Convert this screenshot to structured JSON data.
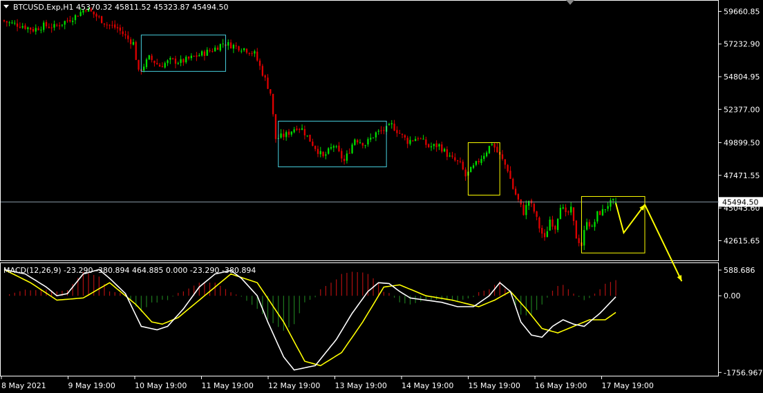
{
  "symbol_line": "BTCUSD.Exp,H1  45370.32 45811.52 45323.87 45494.50",
  "macd_label": "MACD(12,26,9) -23.290 -380.894 464.885 0.000 -23.290 -380.894",
  "current_price_label": "45494.50",
  "colors": {
    "bull": "#00e000",
    "bear": "#e00000",
    "macd_main": "#ffffff",
    "macd_signal": "#ffff00",
    "hist_pos": "#b01010",
    "hist_neg": "#1e7a1e",
    "box_cyan": "#48d1e0",
    "box_yellow": "#ffff00",
    "arrow": "#ffff00",
    "grid": "#ffffff"
  },
  "chart_data": [
    {
      "type": "candlestick",
      "title": "BTCUSD.Exp,H1",
      "ohlc_current": {
        "open": 45370.32,
        "high": 45811.52,
        "low": 45323.87,
        "close": 45494.5
      },
      "y_ticks": [
        59660.85,
        57232.9,
        54804.95,
        52377.0,
        49899.5,
        47471.55,
        45043.6,
        42615.65
      ],
      "ylim": [
        41200,
        60300
      ],
      "x_ticks": [
        "8 May 2021",
        "9 May 19:00",
        "10 May 19:00",
        "11 May 19:00",
        "12 May 19:00",
        "13 May 19:00",
        "14 May 19:00",
        "15 May 19:00",
        "16 May 19:00",
        "17 May 19:00"
      ],
      "current_price": 45494.5,
      "price_path": [
        [
          0,
          59000
        ],
        [
          3,
          58800
        ],
        [
          8,
          58600
        ],
        [
          12,
          58300
        ],
        [
          16,
          58600
        ],
        [
          20,
          58500
        ],
        [
          24,
          58900
        ],
        [
          28,
          59300
        ],
        [
          32,
          59900
        ],
        [
          36,
          59300
        ],
        [
          40,
          58700
        ],
        [
          44,
          58400
        ],
        [
          48,
          57600
        ],
        [
          50,
          57300
        ],
        [
          52,
          55100
        ],
        [
          56,
          56200
        ],
        [
          60,
          55600
        ],
        [
          64,
          56000
        ],
        [
          68,
          55900
        ],
        [
          72,
          56200
        ],
        [
          76,
          56500
        ],
        [
          80,
          56800
        ],
        [
          84,
          57300
        ],
        [
          88,
          57100
        ],
        [
          92,
          56900
        ],
        [
          96,
          56500
        ],
        [
          100,
          54600
        ],
        [
          102,
          53600
        ],
        [
          104,
          50200
        ],
        [
          108,
          50500
        ],
        [
          112,
          51100
        ],
        [
          114,
          50900
        ],
        [
          118,
          49800
        ],
        [
          122,
          48800
        ],
        [
          126,
          49700
        ],
        [
          130,
          48500
        ],
        [
          134,
          50200
        ],
        [
          138,
          49800
        ],
        [
          142,
          50600
        ],
        [
          146,
          50900
        ],
        [
          148,
          51200
        ],
        [
          150,
          50800
        ],
        [
          154,
          50000
        ],
        [
          158,
          50300
        ],
        [
          162,
          49600
        ],
        [
          166,
          49700
        ],
        [
          170,
          48800
        ],
        [
          174,
          48300
        ],
        [
          176,
          47400
        ],
        [
          180,
          48300
        ],
        [
          184,
          49300
        ],
        [
          186,
          49900
        ],
        [
          188,
          49200
        ],
        [
          190,
          48600
        ],
        [
          192,
          47900
        ],
        [
          194,
          46500
        ],
        [
          196,
          45600
        ],
        [
          198,
          44700
        ],
        [
          200,
          45600
        ],
        [
          202,
          44800
        ],
        [
          204,
          43600
        ],
        [
          206,
          42700
        ],
        [
          208,
          44200
        ],
        [
          210,
          43600
        ],
        [
          212,
          45300
        ],
        [
          214,
          44500
        ],
        [
          216,
          44900
        ],
        [
          218,
          42900
        ],
        [
          220,
          42300
        ],
        [
          222,
          44200
        ],
        [
          224,
          43500
        ],
        [
          226,
          44600
        ],
        [
          228,
          44800
        ],
        [
          230,
          45300
        ],
        [
          232,
          45494.5
        ]
      ],
      "x_index_count": 233,
      "annotations": {
        "cyan_boxes": [
          {
            "x": [
              52,
              84
            ],
            "y": [
              55200,
              57900
            ]
          },
          {
            "x": [
              104,
              145
            ],
            "y": [
              48100,
              51500
            ]
          }
        ],
        "yellow_boxes": [
          {
            "x": [
              176,
              188
            ],
            "y": [
              46000,
              49900
            ]
          },
          {
            "x": [
              219,
              243
            ],
            "y": [
              41700,
              45900
            ]
          }
        ],
        "yellow_arrows": [
          [
            [
              232,
              45400
            ],
            [
              235,
              43200
            ],
            [
              243,
              45300
            ]
          ],
          [
            [
              243,
              45300
            ],
            [
              257,
              39600
            ]
          ]
        ]
      }
    },
    {
      "type": "macd",
      "title": "MACD(12,26,9)",
      "params": [
        12,
        26,
        9
      ],
      "values_label": {
        "main": -23.29,
        "signal": -380.894,
        "histogram": 464.885
      },
      "y_ticks": [
        588.686,
        0.0,
        -1756.967
      ],
      "ylim": [
        -1800,
        700
      ],
      "main_path": [
        [
          0,
          600
        ],
        [
          8,
          500
        ],
        [
          16,
          200
        ],
        [
          20,
          0
        ],
        [
          24,
          50
        ],
        [
          30,
          500
        ],
        [
          36,
          600
        ],
        [
          40,
          400
        ],
        [
          46,
          50
        ],
        [
          52,
          -700
        ],
        [
          58,
          -780
        ],
        [
          62,
          -700
        ],
        [
          68,
          -300
        ],
        [
          74,
          200
        ],
        [
          80,
          500
        ],
        [
          86,
          580
        ],
        [
          90,
          400
        ],
        [
          96,
          0
        ],
        [
          100,
          -600
        ],
        [
          106,
          -1400
        ],
        [
          110,
          -1700
        ],
        [
          114,
          -1650
        ],
        [
          118,
          -1600
        ],
        [
          122,
          -1300
        ],
        [
          126,
          -1000
        ],
        [
          132,
          -400
        ],
        [
          138,
          100
        ],
        [
          142,
          300
        ],
        [
          146,
          280
        ],
        [
          150,
          100
        ],
        [
          154,
          -50
        ],
        [
          160,
          -100
        ],
        [
          166,
          -150
        ],
        [
          172,
          -250
        ],
        [
          178,
          -250
        ],
        [
          184,
          0
        ],
        [
          188,
          300
        ],
        [
          192,
          100
        ],
        [
          196,
          -600
        ],
        [
          200,
          -900
        ],
        [
          204,
          -950
        ],
        [
          208,
          -700
        ],
        [
          212,
          -550
        ],
        [
          216,
          -650
        ],
        [
          220,
          -700
        ],
        [
          226,
          -400
        ],
        [
          232,
          -23.29
        ]
      ],
      "signal_path": [
        [
          0,
          600
        ],
        [
          10,
          300
        ],
        [
          20,
          -100
        ],
        [
          30,
          -50
        ],
        [
          40,
          300
        ],
        [
          50,
          -200
        ],
        [
          56,
          -600
        ],
        [
          60,
          -650
        ],
        [
          66,
          -500
        ],
        [
          76,
          0
        ],
        [
          86,
          500
        ],
        [
          96,
          300
        ],
        [
          106,
          -600
        ],
        [
          114,
          -1500
        ],
        [
          120,
          -1600
        ],
        [
          128,
          -1300
        ],
        [
          136,
          -600
        ],
        [
          144,
          200
        ],
        [
          150,
          250
        ],
        [
          160,
          0
        ],
        [
          170,
          -100
        ],
        [
          180,
          -250
        ],
        [
          186,
          -100
        ],
        [
          192,
          100
        ],
        [
          198,
          -300
        ],
        [
          204,
          -750
        ],
        [
          210,
          -850
        ],
        [
          216,
          -700
        ],
        [
          222,
          -550
        ],
        [
          228,
          -550
        ],
        [
          232,
          -380.894
        ]
      ],
      "histogram_note": "positive bars red, negative bars green"
    }
  ]
}
